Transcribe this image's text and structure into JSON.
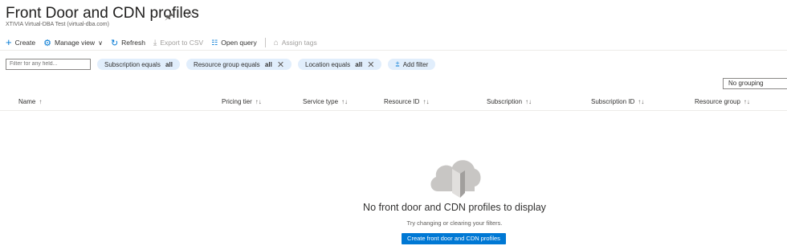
{
  "page": {
    "title": "Front Door and CDN profiles",
    "subtitle": "XTIVIA Virtual-DBA Test (virtual-dba.com)"
  },
  "toolbar": {
    "create": "Create",
    "manage_view": "Manage view",
    "refresh": "Refresh",
    "export_csv": "Export to CSV",
    "open_query": "Open query",
    "assign_tags": "Assign tags"
  },
  "filters": {
    "placeholder": "Filter for any field...",
    "subscription_prefix": "Subscription equals ",
    "subscription_value": "all",
    "resource_group_prefix": "Resource group equals ",
    "resource_group_value": "all",
    "location_prefix": "Location equals ",
    "location_value": "all",
    "add_filter": "Add filter"
  },
  "grouping": {
    "value": "No grouping"
  },
  "columns": [
    {
      "label": "Name"
    },
    {
      "label": "Pricing tier"
    },
    {
      "label": "Service type"
    },
    {
      "label": "Resource ID"
    },
    {
      "label": "Subscription"
    },
    {
      "label": "Subscription ID"
    },
    {
      "label": "Resource group"
    }
  ],
  "empty_state": {
    "title": "No front door and CDN profiles to display",
    "subtitle": "Try changing or clearing your filters.",
    "button": "Create front door and CDN profiles"
  },
  "colors": {
    "accent": "#0078d4",
    "pill_bg": "#e1eefc"
  }
}
